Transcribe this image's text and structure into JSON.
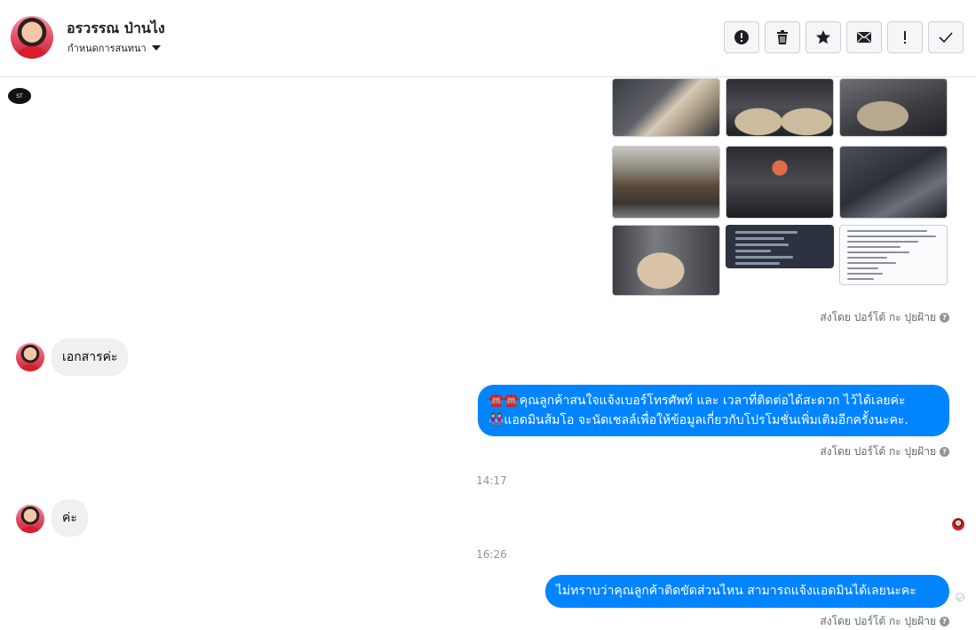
{
  "header": {
    "name": "อรวรรณ ป่านไง",
    "subtitle": "กำหนดการสนทนา",
    "actions": [
      {
        "name": "report-icon",
        "symbol": "!"
      },
      {
        "name": "trash-icon"
      },
      {
        "name": "star-icon",
        "symbol": "★"
      },
      {
        "name": "envelope-icon"
      },
      {
        "name": "exclamation-icon",
        "symbol": "!"
      },
      {
        "name": "check-icon",
        "symbol": "✓"
      }
    ]
  },
  "messages": {
    "sent_by_1": "ส่งโดย ปอร์โต้ กะ ปุยฝ้าย",
    "incoming_1": "เอกสารค่ะ",
    "outgoing_1_line1": "☎️☎️คุณลูกค้าสนใจแจ้งเบอร์โทรศัพท์ และ เวลาที่ติดต่อได้สะดวก ไว้ได้เลยค่ะ",
    "outgoing_1_line2": "👭แอดมินส้มโอ จะนัดเชลล์เพื่อให้ข้อมูลเกี่ยวกับโปรโมชั่นเพิ่มเติมอีกครั้งนะคะ.",
    "sent_by_2": "ส่งโดย ปอร์โต้ กะ ปุยฝ้าย",
    "time_1": "14:17",
    "incoming_2": "ค่ะ",
    "time_2": "16:26",
    "outgoing_2": "ไม่ทราบว่าคุณลูกค้าติดขัดส่วนไหน สามารถแจ้งแอดมินได้เลยนะคะ",
    "sent_by_3": "ส่งโดย ปอร์โต้ กะ ปุยฝ้าย"
  },
  "colors": {
    "accent": "#0084ff",
    "incoming_bubble": "#f1f0f0",
    "meta_text": "#606770"
  }
}
